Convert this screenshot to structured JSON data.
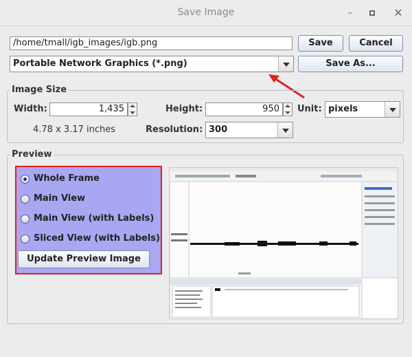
{
  "window": {
    "title": "Save Image",
    "controls": [
      "minimize-icon",
      "maximize-icon",
      "close-icon"
    ]
  },
  "file": {
    "path": "/home/tmall/igb_images/igb.png",
    "format": "Portable Network Graphics (*.png)"
  },
  "buttons": {
    "save": "Save",
    "cancel": "Cancel",
    "save_as": "Save As..."
  },
  "image_size": {
    "group_label": "Image Size",
    "width_label": "Width:",
    "width_value": "1,435",
    "height_label": "Height:",
    "height_value": "950",
    "unit_label": "Unit:",
    "unit_value": "pixels",
    "inches": "4.78 x 3.17 inches",
    "resolution_label": "Resolution:",
    "resolution_value": "300"
  },
  "preview": {
    "group_label": "Preview",
    "options": [
      {
        "label": "Whole Frame",
        "selected": true
      },
      {
        "label": "Main View",
        "selected": false
      },
      {
        "label": "Main View (with Labels)",
        "selected": false
      },
      {
        "label": "Sliced View (with Labels)",
        "selected": false
      }
    ],
    "update_button": "Update Preview Image"
  },
  "colors": {
    "highlight_border": "#e21f1f",
    "radio_panel_bg": "#a9a6f2",
    "annotation_arrow": "#e21f1f"
  }
}
